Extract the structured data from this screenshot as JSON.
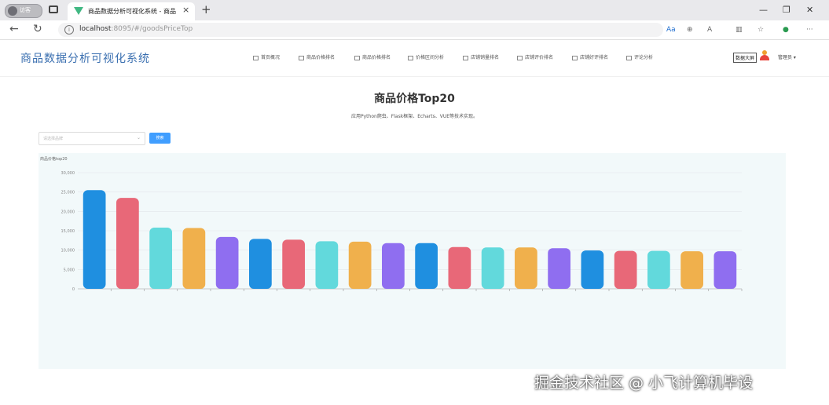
{
  "browser": {
    "profile_label": "访客",
    "tab_title": "商品数据分析可视化系统 - 商品",
    "url_host": "localhost",
    "url_rest": ":8095/#/goodsPriceTop"
  },
  "app": {
    "brand": "商品数据分析可视化系统",
    "menu": [
      "首页概况",
      "商品价格排名",
      "商品价格排名",
      "价格区间分析",
      "店铺销量排名",
      "店铺评价排名",
      "店铺好评排名",
      "评论分析"
    ],
    "bigscreen_label": "数据大屏",
    "username": "管理员"
  },
  "page": {
    "title": "商品价格Top20",
    "subtitle": "应用Python爬虫、Flask框架、Echarts、VUE等技术实现。",
    "select_placeholder": "请选择品牌",
    "search_label": "搜索"
  },
  "chart_data": {
    "type": "bar",
    "title": "商品价格top20",
    "ylim": [
      0,
      30000
    ],
    "yticks": [
      "0",
      "5,000",
      "10,000",
      "15,000",
      "20,000",
      "25,000",
      "30,000"
    ],
    "colors": [
      "#1f8fe0",
      "#e86878",
      "#62d9dc",
      "#f0b04c",
      "#8f6ef0"
    ],
    "values": [
      25500,
      23500,
      15800,
      15700,
      13400,
      12900,
      12700,
      12300,
      12200,
      11800,
      11800,
      10800,
      10700,
      10700,
      10500,
      9900,
      9800,
      9800,
      9700,
      9700
    ]
  },
  "watermark": "掘金技术社区 @ 小飞计算机毕设"
}
